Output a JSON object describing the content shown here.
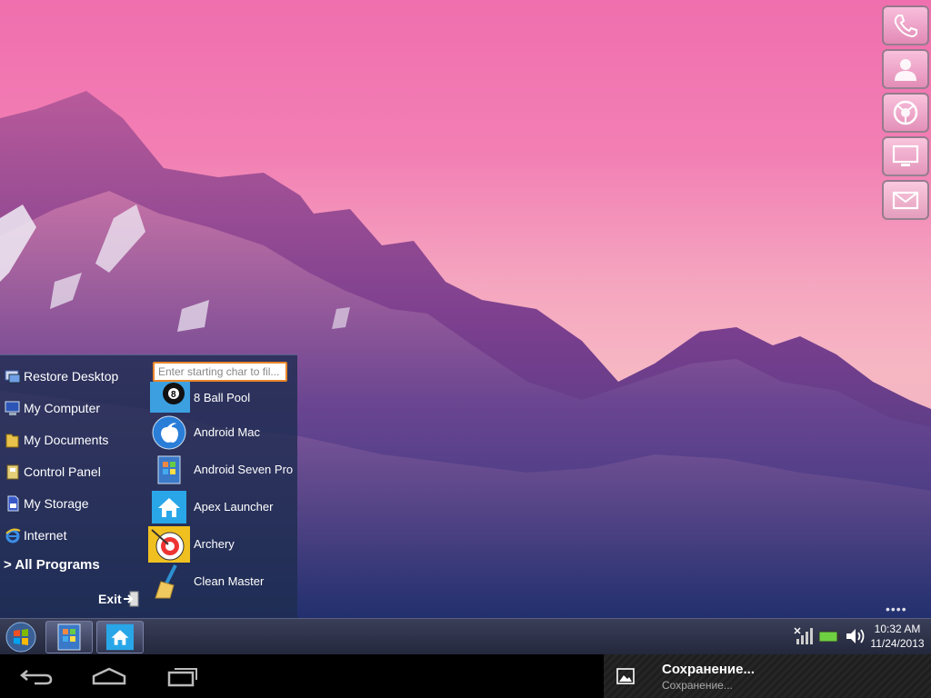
{
  "quick_launch": [
    {
      "name": "phone-button",
      "icon": "phone-icon"
    },
    {
      "name": "contacts-button",
      "icon": "person-icon"
    },
    {
      "name": "browser-button",
      "icon": "globe-icon"
    },
    {
      "name": "desktop-button",
      "icon": "monitor-icon"
    },
    {
      "name": "mail-button",
      "icon": "mail-icon"
    }
  ],
  "start_menu": {
    "left_items": [
      {
        "label": "Restore Desktop",
        "icon": "restore-desktop-icon"
      },
      {
        "label": "My Computer",
        "icon": "computer-icon"
      },
      {
        "label": "My Documents",
        "icon": "folder-icon"
      },
      {
        "label": "Control Panel",
        "icon": "control-panel-icon"
      },
      {
        "label": "My Storage",
        "icon": "sd-card-icon"
      },
      {
        "label": "Internet",
        "icon": "internet-explorer-icon"
      }
    ],
    "all_programs": "> All Programs",
    "exit": "Exit",
    "search_placeholder": "Enter starting char to fil...",
    "apps": [
      {
        "label": "8 Ball Pool",
        "icon": "eight-ball-icon"
      },
      {
        "label": "Android Mac",
        "icon": "apple-icon"
      },
      {
        "label": "Android Seven Pro",
        "icon": "android-seven-icon"
      },
      {
        "label": "Apex Launcher",
        "icon": "home-icon"
      },
      {
        "label": "Archery",
        "icon": "archery-target-icon"
      },
      {
        "label": "Clean Master",
        "icon": "broom-icon"
      }
    ]
  },
  "taskbar": {
    "clock_time": "10:32 AM",
    "clock_date": "11/24/2013",
    "tray_icons": [
      "signal-icon",
      "battery-icon",
      "volume-icon"
    ]
  },
  "navbar": {
    "buttons": [
      "back-icon",
      "home-icon",
      "recents-icon"
    ]
  },
  "notification": {
    "title": "Сохранение...",
    "subtitle": "Сохранение..."
  },
  "page_indicator": "••••"
}
